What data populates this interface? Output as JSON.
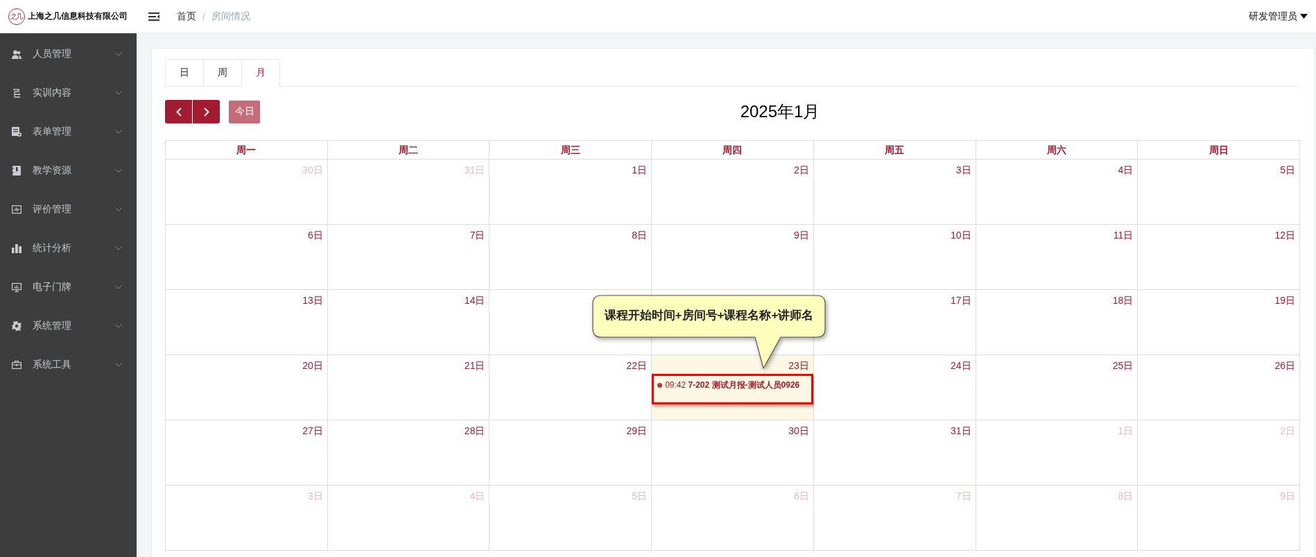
{
  "header": {
    "logo_text": "之几",
    "company": "上海之几信息科技有限公司",
    "breadcrumb": [
      {
        "label": "首页",
        "current": false
      },
      {
        "label": "房间情况",
        "current": true
      }
    ],
    "breadcrumb_separator": "/",
    "user": "研发管理员"
  },
  "sidebar": {
    "items": [
      {
        "label": "人员管理",
        "expanded": false
      },
      {
        "label": "实训内容",
        "expanded": false
      },
      {
        "label": "表单管理",
        "expanded": false
      },
      {
        "label": "教学资源",
        "expanded": false
      },
      {
        "label": "评价管理",
        "expanded": false
      },
      {
        "label": "统计分析",
        "expanded": false
      },
      {
        "label": "电子门牌",
        "expanded": false
      },
      {
        "label": "系统管理",
        "expanded": false
      },
      {
        "label": "系统工具",
        "expanded": false
      }
    ]
  },
  "tabs": [
    {
      "label": "日",
      "selected": false
    },
    {
      "label": "周",
      "selected": false
    },
    {
      "label": "月",
      "selected": true
    }
  ],
  "toolbar": {
    "today": {
      "label": "今日",
      "disabled": true
    }
  },
  "calendar": {
    "title": "2025年1月",
    "weekdays": [
      "周一",
      "周二",
      "周三",
      "周四",
      "周五",
      "周六",
      "周日"
    ],
    "weeks": [
      [
        {
          "label": "30日",
          "other_month": true,
          "today": false
        },
        {
          "label": "31日",
          "other_month": true,
          "today": false
        },
        {
          "label": "1日",
          "other_month": false,
          "today": false
        },
        {
          "label": "2日",
          "other_month": false,
          "today": false
        },
        {
          "label": "3日",
          "other_month": false,
          "today": false
        },
        {
          "label": "4日",
          "other_month": false,
          "today": false
        },
        {
          "label": "5日",
          "other_month": false,
          "today": false
        }
      ],
      [
        {
          "label": "6日",
          "other_month": false,
          "today": false
        },
        {
          "label": "7日",
          "other_month": false,
          "today": false
        },
        {
          "label": "8日",
          "other_month": false,
          "today": false
        },
        {
          "label": "9日",
          "other_month": false,
          "today": false
        },
        {
          "label": "10日",
          "other_month": false,
          "today": false
        },
        {
          "label": "11日",
          "other_month": false,
          "today": false
        },
        {
          "label": "12日",
          "other_month": false,
          "today": false
        }
      ],
      [
        {
          "label": "13日",
          "other_month": false,
          "today": false
        },
        {
          "label": "14日",
          "other_month": false,
          "today": false
        },
        {
          "today": false
        },
        {
          "today": false
        },
        {
          "label": "17日",
          "other_month": false,
          "today": false
        },
        {
          "label": "18日",
          "other_month": false,
          "today": false
        },
        {
          "label": "19日",
          "other_month": false,
          "today": false
        }
      ],
      [
        {
          "label": "20日",
          "other_month": false,
          "today": false
        },
        {
          "label": "21日",
          "other_month": false,
          "today": false
        },
        {
          "label": "22日",
          "other_month": false,
          "today": false
        },
        {
          "label": "23日",
          "other_month": false,
          "today": true,
          "events": [
            {
              "text": "09:42 **7-202 测试月报-测试人员0926**",
              "highlighted": true
            }
          ]
        },
        {
          "label": "24日",
          "other_month": false,
          "today": false
        },
        {
          "label": "25日",
          "other_month": false,
          "today": false
        },
        {
          "label": "26日",
          "other_month": false,
          "today": false
        }
      ],
      [
        {
          "label": "27日",
          "other_month": false,
          "today": false
        },
        {
          "label": "28日",
          "other_month": false,
          "today": false
        },
        {
          "label": "29日",
          "other_month": false,
          "today": false
        },
        {
          "label": "30日",
          "other_month": false,
          "today": false
        },
        {
          "label": "31日",
          "other_month": false,
          "today": false
        },
        {
          "label": "1日",
          "other_month": true,
          "today": false
        },
        {
          "label": "2日",
          "other_month": true,
          "today": false
        }
      ],
      [
        {
          "label": "3日",
          "other_month": true,
          "today": false
        },
        {
          "label": "4日",
          "other_month": true,
          "today": false
        },
        {
          "label": "5日",
          "other_month": true,
          "today": false
        },
        {
          "label": "6日",
          "other_month": true,
          "today": false
        },
        {
          "label": "7日",
          "other_month": true,
          "today": false
        },
        {
          "label": "8日",
          "other_month": true,
          "today": false
        },
        {
          "label": "9日",
          "other_month": true,
          "today": false
        }
      ]
    ]
  },
  "callout": {
    "text": "课程开始时间+房间号+课程名称+讲师名"
  }
}
